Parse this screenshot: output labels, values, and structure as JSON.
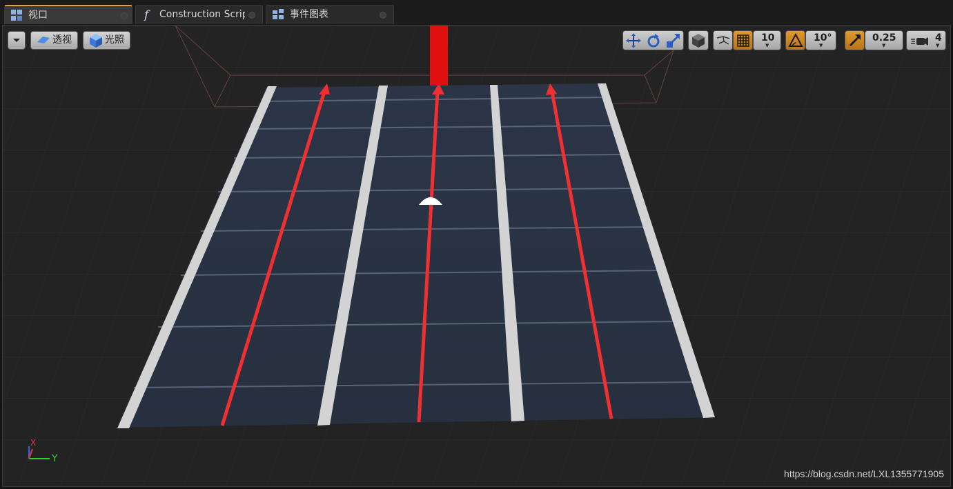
{
  "tabs": [
    {
      "label": "视口",
      "icon": "viewport-grid-icon",
      "active": true
    },
    {
      "label": "Construction Scrip",
      "icon": "function-icon",
      "active": false
    },
    {
      "label": "事件图表",
      "icon": "event-graph-icon",
      "active": false
    }
  ],
  "viewport_toolbar": {
    "perspective_label": "透视",
    "lighting_label": "光照"
  },
  "transform_toolbar": {
    "grid_snap_value": "10",
    "rotation_snap_value": "10°",
    "scale_snap_value": "0.25",
    "camera_speed_value": "4"
  },
  "axis_indicator": {
    "x_label": "X",
    "y_label": "Y"
  },
  "watermark": "https://blog.csdn.net/LXL1355771905",
  "colors": {
    "accent_orange": "#e39a2a",
    "arrow_red": "#f03030",
    "road_blue": "#2a3344",
    "axis_x": "#e23a3a",
    "axis_y": "#2fd12f"
  }
}
